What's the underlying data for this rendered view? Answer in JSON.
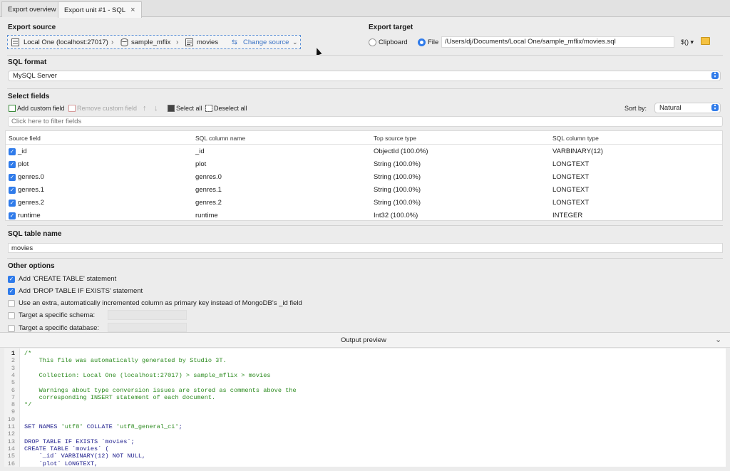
{
  "tabs": [
    {
      "label": "Export overview"
    },
    {
      "label": "Export unit #1 - SQL"
    }
  ],
  "export_source": {
    "heading": "Export source",
    "connection": "Local One (localhost:27017)",
    "database": "sample_mflix",
    "collection": "movies",
    "change_source": "Change source"
  },
  "export_target": {
    "heading": "Export target",
    "clipboard_label": "Clipboard",
    "file_label": "File",
    "selected": "File",
    "file_path": "/Users/dj/Documents/Local One/sample_mflix/movies.sql",
    "variable_button": "$()"
  },
  "sql_format": {
    "heading": "SQL format",
    "value": "MySQL Server"
  },
  "select_fields": {
    "heading": "Select fields",
    "toolbar": {
      "add_custom": "Add custom field",
      "remove_custom": "Remove custom field",
      "select_all": "Select all",
      "deselect_all": "Deselect all",
      "sort_by_label": "Sort by:",
      "sort_by_value": "Natural"
    },
    "filter_placeholder": "Click here to filter fields",
    "columns": [
      "Source field",
      "SQL column name",
      "Top source type",
      "SQL column type"
    ],
    "rows": [
      {
        "source": "_id",
        "sql": "_id",
        "type": "ObjectId (100.0%)",
        "sqltype": "VARBINARY(12)"
      },
      {
        "source": "plot",
        "sql": "plot",
        "type": "String (100.0%)",
        "sqltype": "LONGTEXT"
      },
      {
        "source": "genres.0",
        "sql": "genres.0",
        "type": "String (100.0%)",
        "sqltype": "LONGTEXT"
      },
      {
        "source": "genres.1",
        "sql": "genres.1",
        "type": "String (100.0%)",
        "sqltype": "LONGTEXT"
      },
      {
        "source": "genres.2",
        "sql": "genres.2",
        "type": "String (100.0%)",
        "sqltype": "LONGTEXT"
      },
      {
        "source": "runtime",
        "sql": "runtime",
        "type": "Int32 (100.0%)",
        "sqltype": "INTEGER"
      }
    ]
  },
  "sql_table": {
    "heading": "SQL table name",
    "value": "movies"
  },
  "other_options": {
    "heading": "Other options",
    "options": [
      {
        "label": "Add 'CREATE TABLE' statement",
        "checked": true
      },
      {
        "label": "Add 'DROP TABLE IF EXISTS' statement",
        "checked": true
      },
      {
        "label": "Use an extra, automatically incremented column as primary key instead of MongoDB's _id field",
        "checked": false
      },
      {
        "label": "Target a specific schema:",
        "checked": false
      },
      {
        "label": "Target a specific database:",
        "checked": false
      }
    ]
  },
  "output_preview": {
    "title": "Output preview",
    "lines": [
      "/*",
      "    This file was automatically generated by Studio 3T.",
      "",
      "    Collection: Local One (localhost:27017) > sample_mflix > movies",
      "",
      "    Warnings about type conversion issues are stored as comments above the",
      "    corresponding INSERT statement of each document.",
      "*/",
      "",
      "",
      "SET NAMES 'utf8' COLLATE 'utf8_general_ci';",
      "",
      "DROP TABLE IF EXISTS `movies`;",
      "CREATE TABLE `movies` (",
      "    `_id` VARBINARY(12) NOT NULL,",
      "    `plot` LONGTEXT,"
    ]
  },
  "colors": {
    "accent": "#2f7bea",
    "comment": "#2b8a1e",
    "code": "#1c1c8c"
  }
}
